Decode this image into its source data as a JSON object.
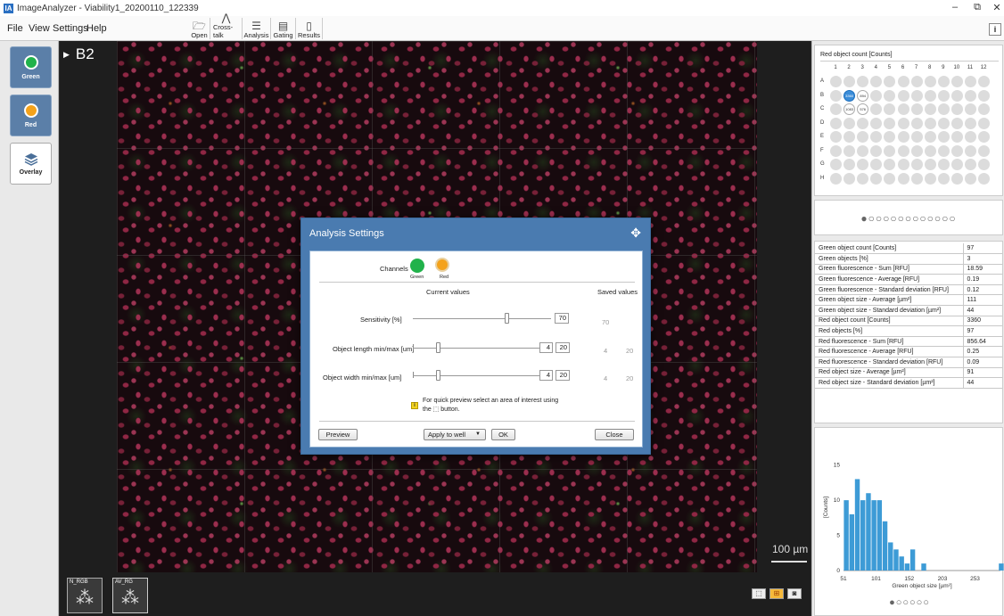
{
  "window": {
    "title": "ImageAnalyzer - Viability1_20200110_122339",
    "app_icon": "IA",
    "controls": {
      "minimize": "–",
      "maximize": "⧉",
      "close": "✕"
    }
  },
  "menu": {
    "file": "File",
    "view": "View",
    "settings": "Settings",
    "help": "Help"
  },
  "toolbar": {
    "open": {
      "label": "Open",
      "icon": "folder-icon"
    },
    "crosstalk": {
      "label": "Cross-talk",
      "icon": "crosstalk-icon"
    },
    "analysis": {
      "label": "Analysis",
      "icon": "sliders-icon"
    },
    "gating": {
      "label": "Gating",
      "icon": "gating-icon"
    },
    "results": {
      "label": "Results",
      "icon": "results-icon"
    },
    "info": "i"
  },
  "channels": [
    {
      "label": "Green",
      "color": "#21b24b"
    },
    {
      "label": "Red",
      "color": "#f4a21b"
    },
    {
      "label": "Overlay",
      "icon": "layers-icon"
    }
  ],
  "viewer": {
    "well_label": "B2",
    "scale_bar": "100 µm",
    "thumbnails": [
      {
        "label": "N_RGB"
      },
      {
        "label": "AV_RG"
      }
    ]
  },
  "plate": {
    "title": "Red object count [Counts]",
    "columns": [
      "1",
      "2",
      "3",
      "4",
      "5",
      "6",
      "7",
      "8",
      "9",
      "10",
      "11",
      "12"
    ],
    "rows": [
      "A",
      "B",
      "C",
      "D",
      "E",
      "F",
      "G",
      "H"
    ],
    "values": {
      "B2": "3360",
      "B3": "894",
      "C2": "1083",
      "C3": "576"
    },
    "selected_well": "B2",
    "pager": "●○○○○○○○○○○○○"
  },
  "stats": [
    {
      "label": "Green object count [Counts]",
      "value": "97"
    },
    {
      "label": "Green objects [%]",
      "value": "3"
    },
    {
      "label": "Green fluorescence - Sum [RFU]",
      "value": "18.59"
    },
    {
      "label": "Green fluorescence - Average [RFU]",
      "value": "0.19"
    },
    {
      "label": "Green fluorescence - Standard deviation [RFU]",
      "value": "0.12"
    },
    {
      "label": "Green object size - Average [µm²]",
      "value": "111"
    },
    {
      "label": "Green object size - Standard deviation [µm²]",
      "value": "44"
    },
    {
      "label": "Red object count [Counts]",
      "value": "3360"
    },
    {
      "label": "Red objects [%]",
      "value": "97"
    },
    {
      "label": "Red fluorescence - Sum [RFU]",
      "value": "856.64"
    },
    {
      "label": "Red fluorescence - Average [RFU]",
      "value": "0.25"
    },
    {
      "label": "Red fluorescence - Standard deviation [RFU]",
      "value": "0.09"
    },
    {
      "label": "Red object size - Average [µm²]",
      "value": "91"
    },
    {
      "label": "Red object size - Standard deviation [µm²]",
      "value": "44"
    }
  ],
  "histogram": {
    "pager": "●○○○○○",
    "chart_data": {
      "type": "bar",
      "xlabel": "Green object size [µm²]",
      "ylabel": "[Counts]",
      "xticks": [
        "51",
        "101",
        "152",
        "203",
        "253"
      ],
      "yticks": [
        "0",
        "5",
        "10",
        "15"
      ],
      "xlim": [
        51,
        292
      ],
      "ylim": [
        0,
        18
      ],
      "bin_width": 8.5,
      "x": [
        51,
        59.5,
        68,
        76.5,
        85,
        93.5,
        102,
        110.5,
        119,
        127.5,
        136,
        144.5,
        153,
        161.5,
        170,
        178.5,
        187,
        195.5,
        204,
        212.5,
        221,
        229.5,
        238,
        246.5,
        255,
        263.5,
        272,
        280.5,
        289
      ],
      "values": [
        10,
        8,
        13,
        10,
        11,
        10,
        10,
        7,
        4,
        3,
        2,
        1,
        3,
        0,
        1,
        0,
        0,
        0,
        0,
        0,
        0,
        0,
        0,
        0,
        0,
        0,
        0,
        0,
        1
      ],
      "bar_color": "#3d9bd6"
    }
  },
  "dialog": {
    "title": "Analysis Settings",
    "move_icon": "✥",
    "channels_label": "Channels",
    "channel_green": "Green",
    "channel_red": "Red",
    "current_values": "Current values",
    "saved_values": "Saved values",
    "sensitivity": {
      "label": "Sensitivity [%]",
      "value": "70",
      "saved": "70",
      "position": 0.7
    },
    "length": {
      "label": "Object length min/max [um]",
      "min": "4",
      "max": "20",
      "saved_min": "4",
      "saved_max": "20"
    },
    "width": {
      "label": "Object width min/max [um]",
      "min": "4",
      "max": "20",
      "saved_min": "4",
      "saved_max": "20"
    },
    "info_text_1": "For quick preview select an area of interest using",
    "info_text_2": "the ⬚ button.",
    "buttons": {
      "preview": "Preview",
      "apply": "Apply to well",
      "ok": "OK",
      "close": "Close"
    }
  }
}
